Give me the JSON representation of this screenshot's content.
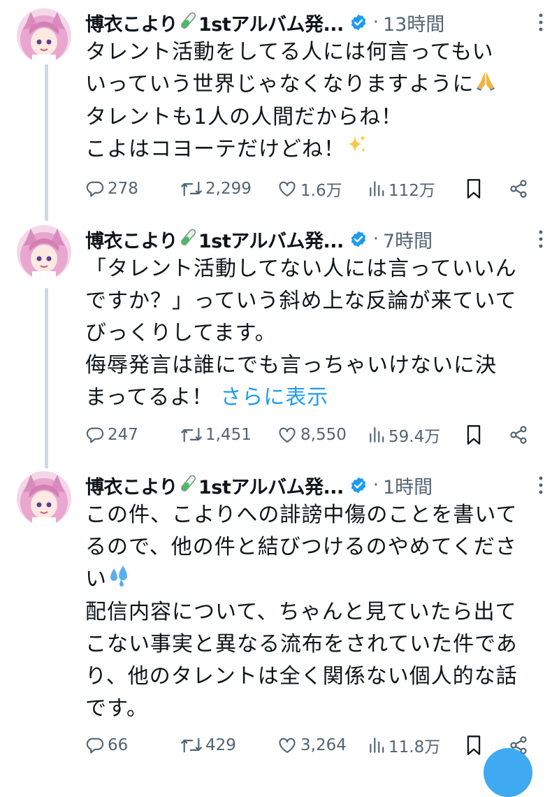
{
  "tweets": [
    {
      "name": "博衣こより",
      "name_suffix": "1stアルバム発...",
      "time": "13時間",
      "lines": [
        "タレント活動をしてる人には何言ってもい",
        "いっていう世界じゃなくなりますように",
        "タレントも1人の人間だからね！",
        "こよはコヨーテだけどね！"
      ],
      "stats": {
        "replies": "278",
        "retweets": "2,299",
        "likes": "1.6万",
        "views": "112万"
      }
    },
    {
      "name": "博衣こより",
      "name_suffix": "1stアルバム発...",
      "time": "7時間",
      "lines": [
        "「タレント活動してない人には言っていいん",
        "ですか？」っていう斜め上な反論が来ていて",
        "びっくりしてます。",
        "侮辱発言は誰にでも言っちゃいけないに決",
        "まってるよ！"
      ],
      "show_more": "さらに表示",
      "stats": {
        "replies": "247",
        "retweets": "1,451",
        "likes": "8,550",
        "views": "59.4万"
      }
    },
    {
      "name": "博衣こより",
      "name_suffix": "1stアルバム発...",
      "time": "1時間",
      "lines": [
        "この件、こよりへの誹謗中傷のことを書いて",
        "るので、他の件と結びつけるのやめてくださ",
        "い",
        "配信内容について、ちゃんと見ていたら出て",
        "こない事実と異なる流布をされていた件であ",
        "り、他のタレントは全く関係ない個人的な話",
        "です。"
      ],
      "stats": {
        "replies": "66",
        "retweets": "429",
        "likes": "3,264",
        "views": "11.8万"
      }
    }
  ],
  "colors": {
    "text": "#0f1419",
    "muted": "#536471",
    "link": "#1d9bf0",
    "verified": "#1d9bf0",
    "thread_line": "#cfd9de"
  },
  "icons": [
    "test-tube-icon",
    "verified-badge-icon",
    "more-options-icon",
    "reply-icon",
    "retweet-icon",
    "like-icon",
    "views-icon",
    "bookmark-icon",
    "share-icon",
    "pray-emoji-icon",
    "sparkles-emoji-icon",
    "sweat-droplets-emoji-icon"
  ]
}
